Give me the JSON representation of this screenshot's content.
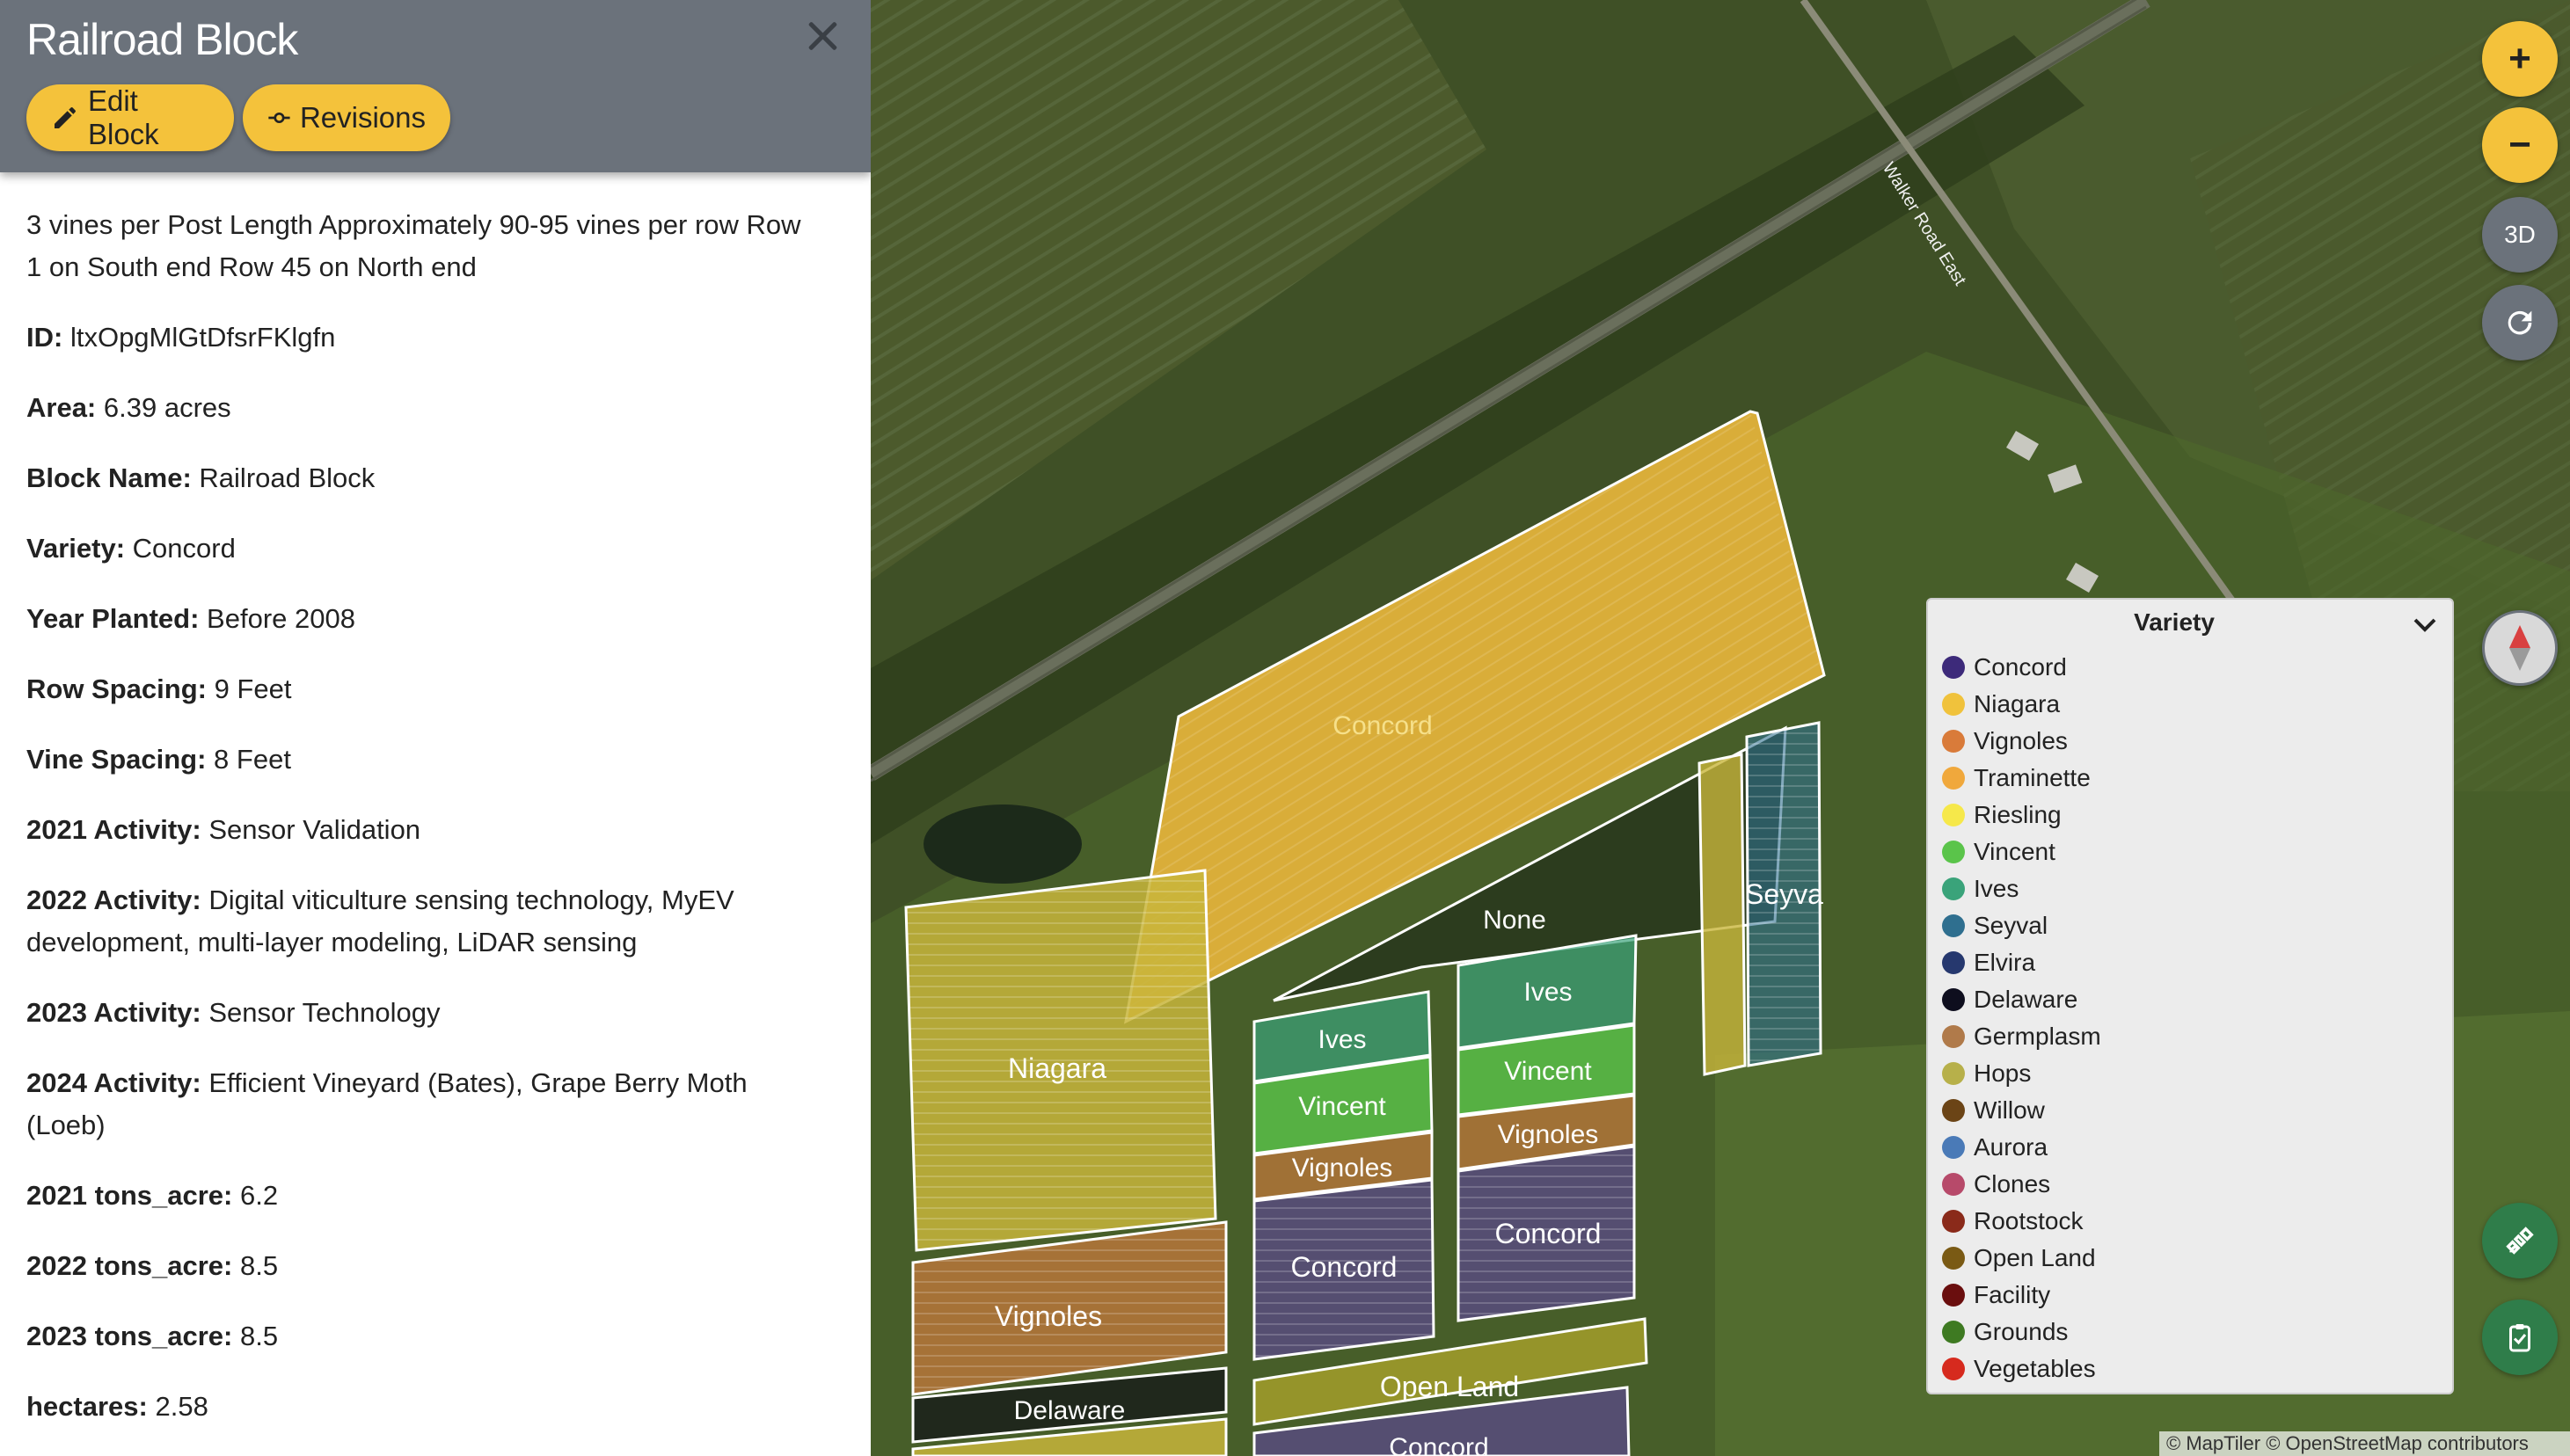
{
  "panel": {
    "title": "Railroad Block",
    "edit_label": "Edit Block",
    "revisions_label": "Revisions",
    "description": "3 vines per Post Length Approximately 90-95 vines per row Row 1 on South end Row 45 on North end",
    "fields": [
      {
        "label": "ID:",
        "value": "ltxOpgMlGtDfsrFKlgfn"
      },
      {
        "label": "Area:",
        "value": "6.39 acres"
      },
      {
        "label": "Block Name:",
        "value": "Railroad Block"
      },
      {
        "label": "Variety:",
        "value": "Concord"
      },
      {
        "label": "Year Planted:",
        "value": "Before 2008"
      },
      {
        "label": "Row Spacing:",
        "value": "9 Feet"
      },
      {
        "label": "Vine Spacing:",
        "value": "8 Feet"
      },
      {
        "label": "2021 Activity:",
        "value": "Sensor Validation"
      },
      {
        "label": "2022 Activity:",
        "value": "Digital viticulture sensing technology, MyEV development, multi-layer modeling, LiDAR sensing"
      },
      {
        "label": "2023 Activity:",
        "value": "Sensor Technology"
      },
      {
        "label": "2024 Activity:",
        "value": "Efficient Vineyard (Bates), Grape Berry Moth (Loeb)"
      },
      {
        "label": "2021 tons_acre:",
        "value": "6.2"
      },
      {
        "label": "2022 tons_acre:",
        "value": "8.5"
      },
      {
        "label": "2023 tons_acre:",
        "value": "8.5"
      },
      {
        "label": "hectares:",
        "value": "2.58"
      }
    ]
  },
  "map": {
    "road_label": "Walker Road East",
    "zoom_in": "+",
    "zoom_out": "−",
    "three_d": "3D",
    "attribution": "© MapTiler © OpenStreetMap contributors",
    "blocks": {
      "concord_main": "Concord",
      "none": "None",
      "niagara": "Niagara",
      "vignoles_left": "Vignoles",
      "delaware": "Delaware",
      "ives_1": "Ives",
      "vincent_1": "Vincent",
      "vignoles_1": "Vignoles",
      "concord_1": "Concord",
      "ives_2": "Ives",
      "vincent_2": "Vincent",
      "vignoles_2": "Vignoles",
      "concord_2": "Concord",
      "seyval": "Seyva",
      "open_land": "Open Land",
      "concord_bottom": "Concord"
    }
  },
  "legend": {
    "title": "Variety",
    "items": [
      {
        "label": "Concord",
        "color": "#3d2a7a"
      },
      {
        "label": "Niagara",
        "color": "#f0c23c"
      },
      {
        "label": "Vignoles",
        "color": "#d97b3a"
      },
      {
        "label": "Traminette",
        "color": "#f0a83c"
      },
      {
        "label": "Riesling",
        "color": "#f6e84a"
      },
      {
        "label": "Vincent",
        "color": "#5ac44a"
      },
      {
        "label": "Ives",
        "color": "#3aa37a"
      },
      {
        "label": "Seyval",
        "color": "#2f6f8f"
      },
      {
        "label": "Elvira",
        "color": "#26386e"
      },
      {
        "label": "Delaware",
        "color": "#0e0e1e"
      },
      {
        "label": "Germplasm",
        "color": "#b07a4a"
      },
      {
        "label": "Hops",
        "color": "#b7b04a"
      },
      {
        "label": "Willow",
        "color": "#6b4416"
      },
      {
        "label": "Aurora",
        "color": "#4a7ab7"
      },
      {
        "label": "Clones",
        "color": "#b74a6a"
      },
      {
        "label": "Rootstock",
        "color": "#8a2a1a"
      },
      {
        "label": "Open Land",
        "color": "#7a5a14"
      },
      {
        "label": "Facility",
        "color": "#6a0e0e"
      },
      {
        "label": "Grounds",
        "color": "#3e7a22"
      },
      {
        "label": "Vegetables",
        "color": "#d62a1e"
      }
    ]
  }
}
